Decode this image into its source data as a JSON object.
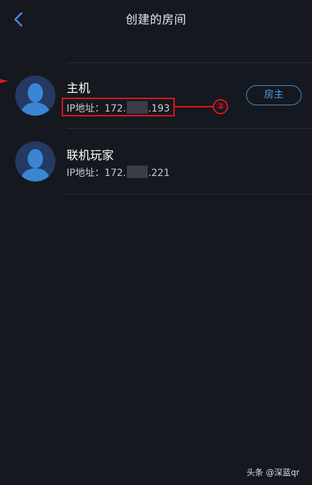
{
  "header": {
    "title": "创建的房间",
    "back_icon": "chevron-left-icon"
  },
  "players": [
    {
      "name": "主机",
      "ip_label": "IP地址：",
      "ip_prefix": "172.",
      "ip_suffix": ".193",
      "badge": "房主",
      "avatar_icon": "user-avatar-icon"
    },
    {
      "name": "联机玩家",
      "ip_label": "IP地址：",
      "ip_prefix": "172.",
      "ip_suffix": ".221",
      "avatar_icon": "user-avatar-icon"
    }
  ],
  "annotation": {
    "number": "②",
    "color": "#e0161c"
  },
  "watermark": "头条 @深蓝qr",
  "colors": {
    "background": "#161820",
    "accent": "#4aa2ea",
    "avatar": "#3a86d4"
  }
}
